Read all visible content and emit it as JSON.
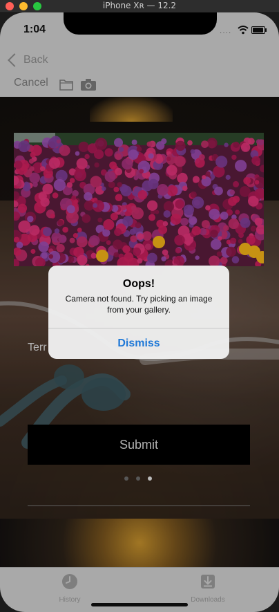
{
  "simulator": {
    "title": "iPhone Xʀ — 12.2"
  },
  "status": {
    "time": "1:04",
    "signal": "····"
  },
  "nav": {
    "back_label": "Back"
  },
  "toolbar": {
    "cancel_label": "Cancel",
    "folder_icon": "folder-icon",
    "camera_icon": "camera-icon"
  },
  "form": {
    "terms_text": "Terr",
    "submit_label": "Submit",
    "page_indicator": {
      "count": 3,
      "active_index": 2
    }
  },
  "alert": {
    "title": "Oops!",
    "message": "Camera not found. Try picking an image from your gallery.",
    "dismiss_label": "Dismiss"
  },
  "tabbar": {
    "items": [
      {
        "label": "History",
        "icon": "clock-icon"
      },
      {
        "label": "Downloads",
        "icon": "download-icon"
      }
    ]
  },
  "colors": {
    "accent": "#1e78d7",
    "bar_background": "#cfcfcf",
    "inactive": "#9a9a9a"
  }
}
